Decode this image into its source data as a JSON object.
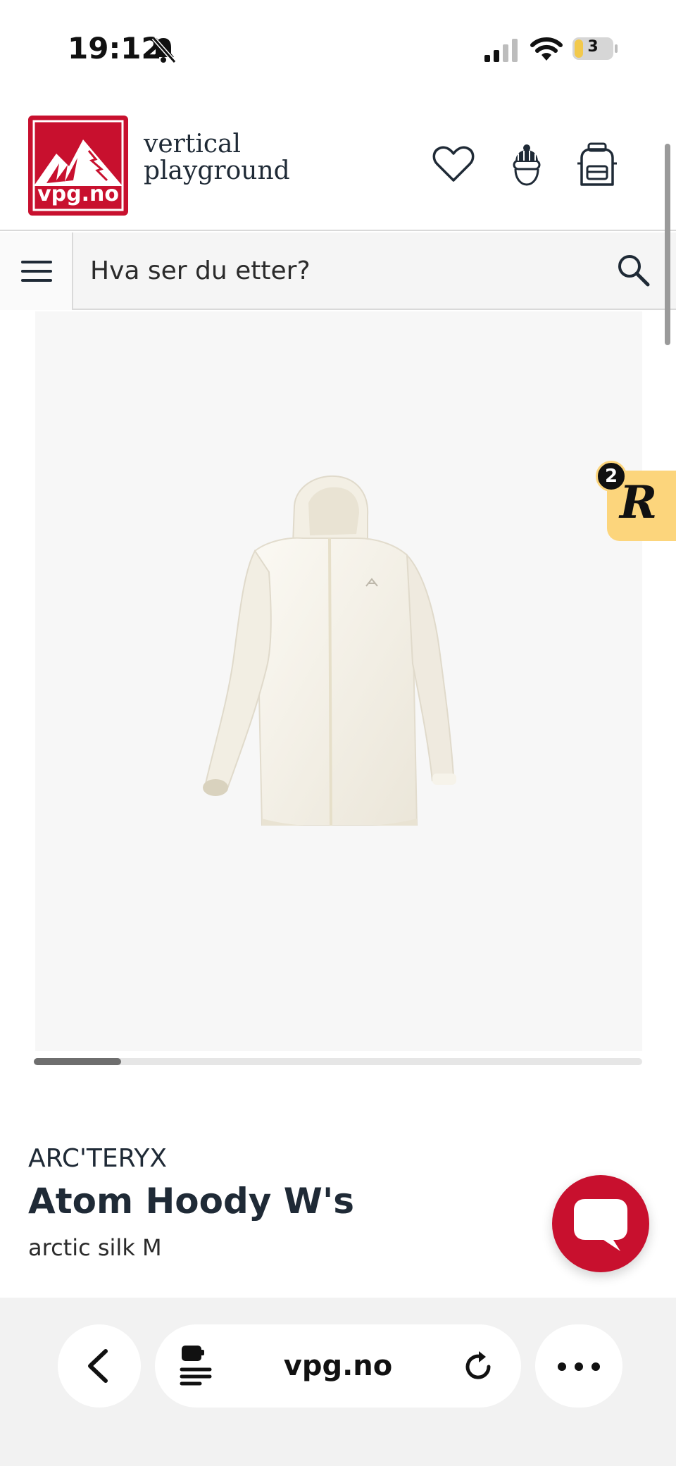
{
  "status_bar": {
    "time": "19:12",
    "battery_level": "3",
    "icons": [
      "bell-slash-icon",
      "cellular-signal-icon",
      "wifi-icon",
      "battery-icon"
    ]
  },
  "header": {
    "logo_text": "vpg.no",
    "brand_line1": "vertical",
    "brand_line2": "playground",
    "icons": [
      "heart-icon",
      "user-icon",
      "backpack-icon"
    ]
  },
  "search": {
    "placeholder": "Hva ser du etter?"
  },
  "floating_widget": {
    "count": "2",
    "letter": "R",
    "color": "#fcd57c"
  },
  "product": {
    "brand": "ARC'TERYX",
    "title": "Atom Hoody W's",
    "variant": "arctic silk M"
  },
  "browser": {
    "url": "vpg.no"
  },
  "colors": {
    "brand_red": "#c8102e",
    "text_dark": "#1f2a36"
  }
}
